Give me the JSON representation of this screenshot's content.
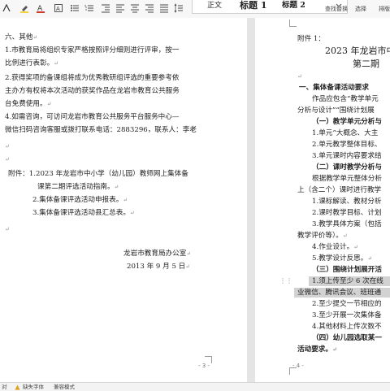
{
  "toolbar": {
    "style_normal": "正文",
    "style_heading1": "标题 1",
    "style_heading2": "标题 2",
    "find_replace": "查找替换",
    "select": "选择",
    "arrange": "排版"
  },
  "left_page": {
    "lines": [
      "六、其他",
      "1.市教育局将组织专家严格按照评分细则进行评审，按一",
      "比例进行表彰。",
      "2.获得奖项的备课组将成为优秀教研组评选的重要参考依",
      "主办方有权将本次活动的获奖作品在龙岩市教育公共服务",
      "台免费使用。",
      "4.如需咨询，可访问龙岩市教育公共服务平台服务中心—",
      "微信扫码咨询客服或拨打联系电话：2883296，联系人：李老",
      "附件：1.2023 年龙岩市中小学（幼儿园）教师网上集体备",
      "课第二期评选活动指南。",
      "2.集体备课评选活动申报表。",
      "3.集体备课评选活动县汇总表。",
      "龙岩市教育局办公室",
      "2013 年 9 月 5 日"
    ],
    "page_number": "- 3 -"
  },
  "right_page": {
    "lines": [
      "附件 1：",
      "2023 年龙岩市中",
      "第二期",
      "一、集体备课活动要求",
      "作品应包含“教学单元",
      "分析与设计”“围绕计划展",
      "（一）教学单元分析与",
      "1.单元“大概念、大主",
      "2.单元教学整体目标、",
      "3.单元课时内容要求结",
      "（二）课时教学分析与",
      "根据教学单元整体分析",
      "上（含二个）课时进行教学",
      "1.课标解读、教材分析",
      "2.课时教学目标、计划",
      "3.教学具体方案（包括",
      "教学评价等）。",
      "4.作业设计。",
      "5.教学设计反思。",
      "（三）围绕计划展开活",
      "1.须上传至少 6 次在线",
      "业微信、腾讯会议、班班通",
      "2.至少提交一节相应的",
      "3.至少开展一次集体备",
      "4.其他材料上传次数不",
      "（四）幼儿园选取某一",
      "活动要求。"
    ],
    "page_number": "- 4 -"
  },
  "statusbar": {
    "missing_font": "缺失字体",
    "compat_mode": "兼容模式"
  }
}
